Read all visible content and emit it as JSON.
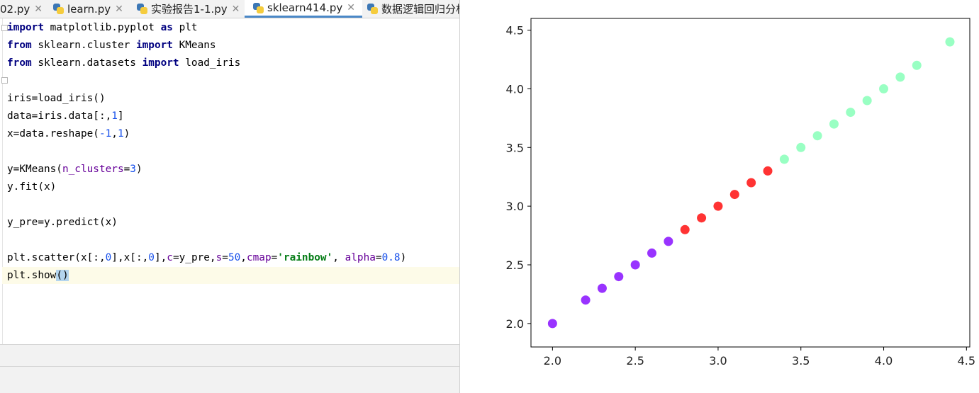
{
  "tabs": [
    {
      "label": "02.py",
      "has_icon": false,
      "active": false
    },
    {
      "label": "learn.py",
      "has_icon": true,
      "active": false
    },
    {
      "label": "实验报告1-1.py",
      "has_icon": true,
      "active": false
    },
    {
      "label": "sklearn414.py",
      "has_icon": true,
      "active": true
    },
    {
      "label": "数据逻辑回归分析",
      "has_icon": true,
      "active": false
    }
  ],
  "code": {
    "line1": {
      "kw1": "import",
      "rest1": " matplotlib.pyplot ",
      "kw2": "as",
      "rest2": " plt"
    },
    "line2": {
      "kw1": "from",
      "rest1": " sklearn.cluster ",
      "kw2": "import",
      "rest2": " KMeans"
    },
    "line3": {
      "kw1": "from",
      "rest1": " sklearn.datasets ",
      "kw2": "import",
      "rest2": " load_iris"
    },
    "line5": "iris=load_iris()",
    "line6": {
      "a": "data=iris.data[:,",
      "n1": "1",
      "b": "]"
    },
    "line7": {
      "a": "x=data.reshape(",
      "n1": "-1",
      "b": ",",
      "n2": "1",
      "c": ")"
    },
    "line9": {
      "a": "y=KMeans(",
      "p": "n_clusters",
      "b": "=",
      "n1": "3",
      "c": ")"
    },
    "line10": "y.fit(x)",
    "line12": "y_pre=y.predict(x)",
    "line14": {
      "a": "plt.scatter(x[:,",
      "n1": "0",
      "b": "],x[:,",
      "n2": "0",
      "c": "],",
      "p1": "c",
      "d": "=y_pre,",
      "p2": "s",
      "e": "=",
      "n3": "50",
      "f": ",",
      "p3": "cmap",
      "g": "=",
      "s1": "'rainbow'",
      "h": ", ",
      "p4": "alpha",
      "i": "=",
      "n4": "0.8",
      "j": ")"
    },
    "line15": {
      "a": "plt.show",
      "b": "()"
    }
  },
  "colors": {
    "cluster_purple": "#8000ff",
    "cluster_red": "#ff0000",
    "cluster_green": "#80ffb4"
  },
  "chart_data": {
    "type": "scatter",
    "title": "",
    "xlabel": "",
    "ylabel": "",
    "xlim": [
      1.87,
      4.52
    ],
    "ylim": [
      1.8,
      4.6
    ],
    "xticks": [
      "2.0",
      "2.5",
      "3.0",
      "3.5",
      "4.0",
      "4.5"
    ],
    "yticks": [
      "2.0",
      "2.5",
      "3.0",
      "3.5",
      "4.0",
      "4.5"
    ],
    "xtick_values": [
      2.0,
      2.5,
      3.0,
      3.5,
      4.0,
      4.5
    ],
    "ytick_values": [
      2.0,
      2.5,
      3.0,
      3.5,
      4.0,
      4.5
    ],
    "grid": false,
    "alpha": 0.8,
    "points": [
      {
        "x": 2.0,
        "y": 2.0,
        "cluster": 0
      },
      {
        "x": 2.2,
        "y": 2.2,
        "cluster": 0
      },
      {
        "x": 2.3,
        "y": 2.3,
        "cluster": 0
      },
      {
        "x": 2.4,
        "y": 2.4,
        "cluster": 0
      },
      {
        "x": 2.5,
        "y": 2.5,
        "cluster": 0
      },
      {
        "x": 2.6,
        "y": 2.6,
        "cluster": 0
      },
      {
        "x": 2.7,
        "y": 2.7,
        "cluster": 0
      },
      {
        "x": 2.8,
        "y": 2.8,
        "cluster": 1
      },
      {
        "x": 2.9,
        "y": 2.9,
        "cluster": 1
      },
      {
        "x": 3.0,
        "y": 3.0,
        "cluster": 1
      },
      {
        "x": 3.1,
        "y": 3.1,
        "cluster": 1
      },
      {
        "x": 3.2,
        "y": 3.2,
        "cluster": 1
      },
      {
        "x": 3.3,
        "y": 3.3,
        "cluster": 1
      },
      {
        "x": 3.4,
        "y": 3.4,
        "cluster": 2
      },
      {
        "x": 3.5,
        "y": 3.5,
        "cluster": 2
      },
      {
        "x": 3.6,
        "y": 3.6,
        "cluster": 2
      },
      {
        "x": 3.7,
        "y": 3.7,
        "cluster": 2
      },
      {
        "x": 3.8,
        "y": 3.8,
        "cluster": 2
      },
      {
        "x": 3.9,
        "y": 3.9,
        "cluster": 2
      },
      {
        "x": 4.0,
        "y": 4.0,
        "cluster": 2
      },
      {
        "x": 4.1,
        "y": 4.1,
        "cluster": 2
      },
      {
        "x": 4.2,
        "y": 4.2,
        "cluster": 2
      },
      {
        "x": 4.4,
        "y": 4.4,
        "cluster": 2
      }
    ]
  }
}
